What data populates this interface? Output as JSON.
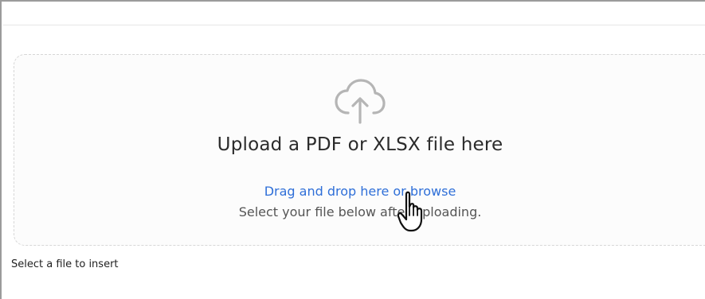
{
  "upload": {
    "icon": "cloud-upload-icon",
    "title": "Upload a PDF or XLSX file here",
    "browse_link": "Drag and drop here or browse",
    "hint": "Select your file below after uploading."
  },
  "footer": {
    "select_label": "Select a file to insert"
  },
  "cursor": {
    "icon": "hand-pointer-icon"
  },
  "colors": {
    "link": "#2f6fd8",
    "title": "#2b2b2b",
    "hint": "#555555",
    "icon": "#b5b5b5"
  }
}
